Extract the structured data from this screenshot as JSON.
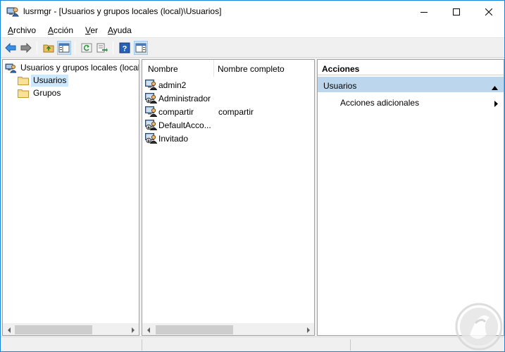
{
  "window": {
    "title": "lusrmgr - [Usuarios y grupos locales (local)\\Usuarios]"
  },
  "menu": {
    "items": [
      {
        "label_ul": "A",
        "label_rest": "rchivo"
      },
      {
        "label_ul": "A",
        "label_rest": "cción"
      },
      {
        "label_ul": "V",
        "label_rest": "er"
      },
      {
        "label_ul": "A",
        "label_rest": "yuda"
      }
    ]
  },
  "toolbar": {
    "icons": [
      "back-arrow-icon",
      "forward-arrow-icon",
      "up-folder-icon",
      "show-tree-icon",
      "refresh-icon",
      "export-list-icon",
      "help-icon",
      "show-action-pane-icon"
    ]
  },
  "tree": {
    "root_label": "Usuarios y grupos locales (local)",
    "children": [
      {
        "label": "Usuarios",
        "selected": true
      },
      {
        "label": "Grupos",
        "selected": false
      }
    ]
  },
  "list": {
    "columns": [
      "Nombre",
      "Nombre completo"
    ],
    "rows": [
      {
        "name": "admin2",
        "full": ""
      },
      {
        "name": "Administrador",
        "full": ""
      },
      {
        "name": "compartir",
        "full": "compartir"
      },
      {
        "name": "DefaultAcco...",
        "full": ""
      },
      {
        "name": "Invitado",
        "full": ""
      }
    ]
  },
  "actions": {
    "header": "Acciones",
    "group_label": "Usuarios",
    "item_label": "Acciones adicionales"
  },
  "colors": {
    "accent_border": "#1883d7",
    "selection": "#cce8ff",
    "action_group_bg": "#bcd6ee"
  }
}
